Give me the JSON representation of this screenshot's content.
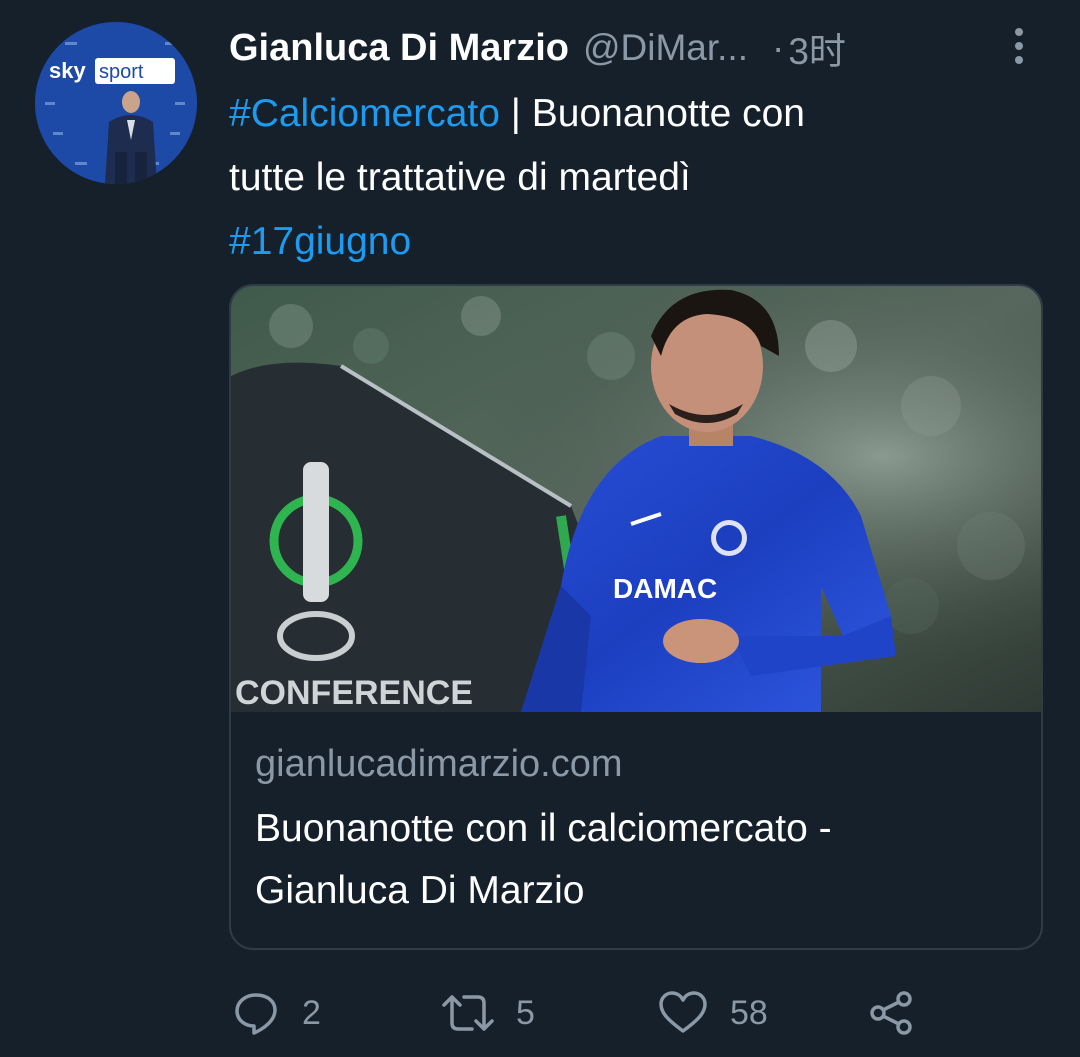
{
  "author": {
    "name": "Gianluca Di Marzio",
    "handle": "@DiMar...",
    "separator": "·",
    "time": "3时"
  },
  "avatar": {
    "logo_sky": "sky",
    "logo_sport": "sport"
  },
  "tweet": {
    "hashtag1": "#Calciomercato",
    "line1_rest": " | Buonanotte con",
    "line2": "tutte le trattative di martedì",
    "hashtag2": "#17giugno"
  },
  "card": {
    "domain": "gianlucadimarzio.com",
    "title_line1": "Buonanotte con il calciomercato -",
    "title_line2": "Gianluca Di Marzio",
    "image_text_sponsor": "DAMAC",
    "image_text_banner": "CONFERENCE"
  },
  "actions": {
    "replies": "2",
    "retweets": "5",
    "likes": "58"
  },
  "colors": {
    "background": "#15202b",
    "hashtag": "#1d9bf0",
    "muted": "#8b98a5",
    "border": "#2f3b47"
  }
}
